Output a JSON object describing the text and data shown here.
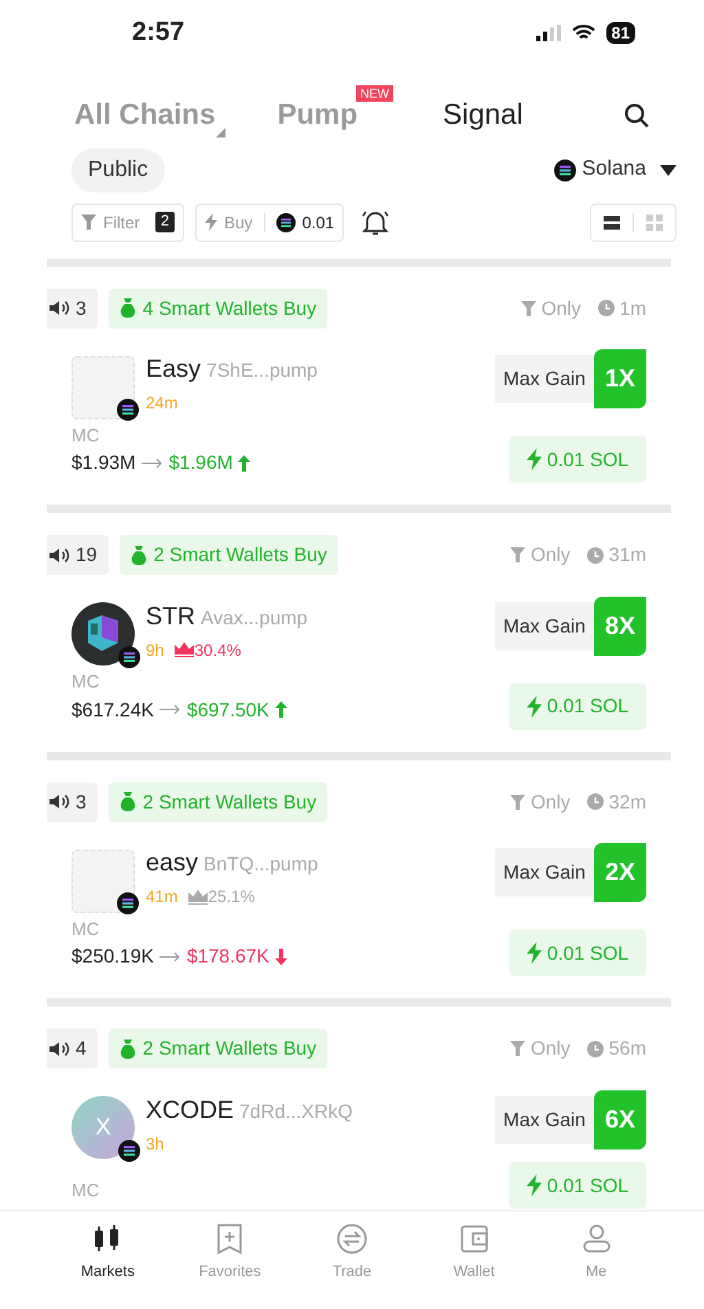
{
  "status_bar": {
    "time": "2:57",
    "battery": "81"
  },
  "tabs": [
    {
      "label": "All Chains",
      "kind": "dropdown",
      "selected": false
    },
    {
      "label": "Pump",
      "kind": "badge",
      "badge": "NEW",
      "selected": false
    },
    {
      "label": "Signal",
      "kind": "plain",
      "selected": true
    }
  ],
  "scope": "Public",
  "chain": "Solana",
  "toolbar": {
    "filter_label": "Filter",
    "filter_count": "2",
    "buy_label": "Buy",
    "buy_amount": "0.01"
  },
  "view_modes": [
    {
      "selected": true
    },
    {
      "selected": false
    }
  ],
  "signals": [
    {
      "mentions": "3",
      "smart_wallets": "4 Smart Wallets Buy",
      "filter_label": "Only",
      "age": "1m",
      "avatar": {
        "kind": "logo"
      },
      "token_name": "Easy",
      "address": "7ShE...pump",
      "token_age": "24m",
      "mc_label": "MC",
      "mc_from": "$1.93M",
      "mc_to": "$1.96M",
      "rising": true,
      "max_gain_label": "Max Gain",
      "max_gain": "1X",
      "buy": "0.01 SOL"
    },
    {
      "mentions": "19",
      "smart_wallets": "2 Smart Wallets Buy",
      "filter_label": "Only",
      "age": "31m",
      "avatar": {
        "kind": "cube"
      },
      "token_name": "STR",
      "address": "Avax...pump",
      "token_age": "9h",
      "top_share": "30.4%",
      "top_hot": true,
      "mc_label": "MC",
      "mc_from": "$617.24K",
      "mc_to": "$697.50K",
      "rising": true,
      "max_gain_label": "Max Gain",
      "max_gain": "8X",
      "buy": "0.01 SOL"
    },
    {
      "mentions": "3",
      "smart_wallets": "2 Smart Wallets Buy",
      "filter_label": "Only",
      "age": "32m",
      "avatar": {
        "kind": "logo"
      },
      "token_name": "easy",
      "address": "BnTQ...pump",
      "token_age": "41m",
      "top_share": "25.1%",
      "top_hot": false,
      "mc_label": "MC",
      "mc_from": "$250.19K",
      "mc_to": "$178.67K",
      "rising": false,
      "max_gain_label": "Max Gain",
      "max_gain": "2X",
      "buy": "0.01 SOL"
    },
    {
      "mentions": "4",
      "smart_wallets": "2 Smart Wallets Buy",
      "filter_label": "Only",
      "age": "56m",
      "avatar": {
        "kind": "letter",
        "letter": "X"
      },
      "token_name": "XCODE",
      "address": "7dRd...XRkQ",
      "token_age": "3h",
      "mc_label": "MC",
      "max_gain_label": "Max Gain",
      "max_gain": "6X",
      "buy": "0.01 SOL"
    }
  ],
  "nav": [
    {
      "label": "Markets",
      "selected": true
    },
    {
      "label": "Favorites",
      "selected": false
    },
    {
      "label": "Trade",
      "selected": false
    },
    {
      "label": "Wallet",
      "selected": false
    },
    {
      "label": "Me",
      "selected": false
    }
  ]
}
